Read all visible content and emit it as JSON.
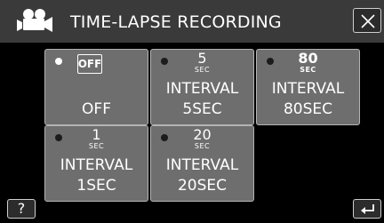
{
  "header": {
    "title": "TIME-LAPSE RECORDING",
    "mode_icon": "movie-camera-icon",
    "close_icon": "close-icon"
  },
  "options": [
    {
      "name": "off",
      "selected": true,
      "badge": "OFF",
      "label": "OFF"
    },
    {
      "name": "interval-5sec",
      "selected": false,
      "value": "5",
      "unit": "SEC",
      "label1": "INTERVAL",
      "label2": "5SEC"
    },
    {
      "name": "interval-80sec",
      "selected": false,
      "value": "80",
      "unit": "SEC",
      "label1": "INTERVAL",
      "label2": "80SEC"
    },
    {
      "name": "interval-1sec",
      "selected": false,
      "value": "1",
      "unit": "SEC",
      "label1": "INTERVAL",
      "label2": "1SEC"
    },
    {
      "name": "interval-20sec",
      "selected": false,
      "value": "20",
      "unit": "SEC",
      "label1": "INTERVAL",
      "label2": "20SEC"
    }
  ],
  "footer": {
    "help_label": "?",
    "back_icon": "return-icon"
  },
  "colors": {
    "header_bg": "#3a3a3a",
    "tile_bg": "#6e6e6e",
    "background": "#000000"
  }
}
